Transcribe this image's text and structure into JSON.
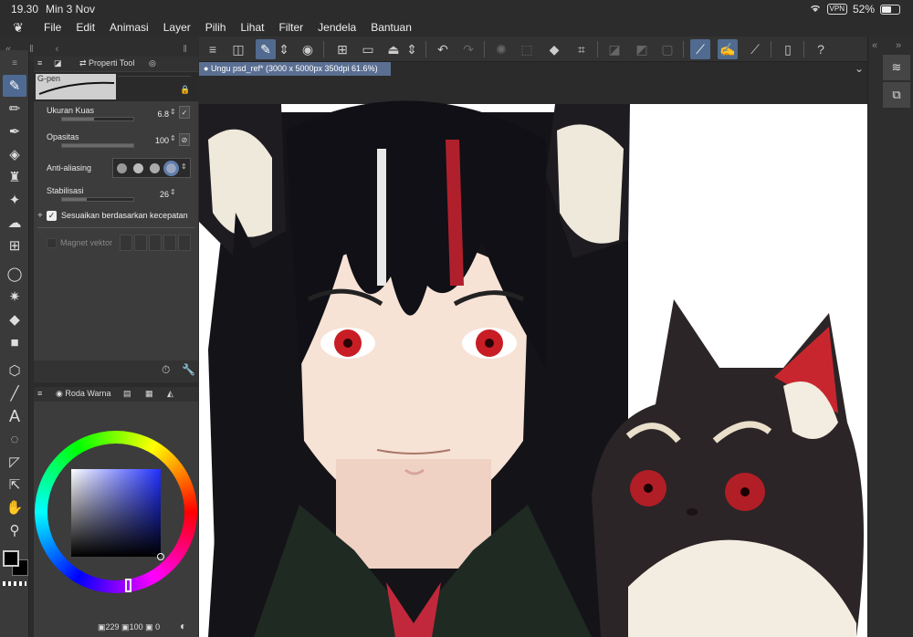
{
  "status_bar": {
    "time": "19.30",
    "date": "Min 3 Nov",
    "vpn": "VPN",
    "battery": "52%"
  },
  "menu": [
    "File",
    "Edit",
    "Animasi",
    "Layer",
    "Pilih",
    "Lihat",
    "Filter",
    "Jendela",
    "Bantuan"
  ],
  "tool_property": {
    "tab_label": "Properti Tool",
    "brush_name": "G-pen",
    "brush_size_label": "Ukuran Kuas",
    "brush_size_value": "6.8",
    "opacity_label": "Opasitas",
    "opacity_value": "100",
    "anti_alias_label": "Anti-aliasing",
    "stabilization_label": "Stabilisasi",
    "stabilization_value": "26",
    "speed_adjust_label": "Sesuaikan berdasarkan kecepatan",
    "vector_magnet_label": "Magnet vektor"
  },
  "color_panel": {
    "tab_label": "Roda Warna",
    "readout": {
      "h": "229",
      "s": "100",
      "v": "0"
    }
  },
  "canvas": {
    "tab_title": "Ungu psd_ref* (3000 x 5000px 350dpi 61.6%)"
  },
  "colors": {
    "accent": "#4e6a93",
    "panel_bg": "#3c3c3c",
    "app_bg": "#2b2b2b"
  }
}
